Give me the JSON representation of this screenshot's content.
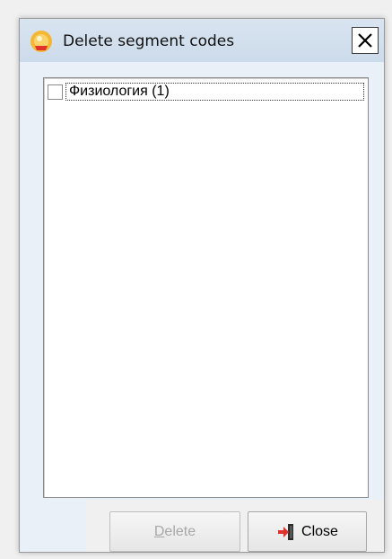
{
  "dialog": {
    "title": "Delete segment codes",
    "close_glyph": "✕"
  },
  "list": {
    "items": [
      {
        "label": "Физиология (1)",
        "checked": false
      }
    ]
  },
  "buttons": {
    "delete_label_first": "D",
    "delete_label_rest": "elete",
    "delete_enabled": false,
    "close_label": "Close"
  },
  "icons": {
    "app": "app-logo-icon",
    "close_button": "exit-door-icon"
  },
  "colors": {
    "titlebar": "#d3e0ee",
    "window_bg": "#eaf0f7",
    "disabled_text": "#a8a8a8",
    "exit_icon_red": "#e0312d",
    "exit_icon_dark": "#2b2b2b"
  }
}
